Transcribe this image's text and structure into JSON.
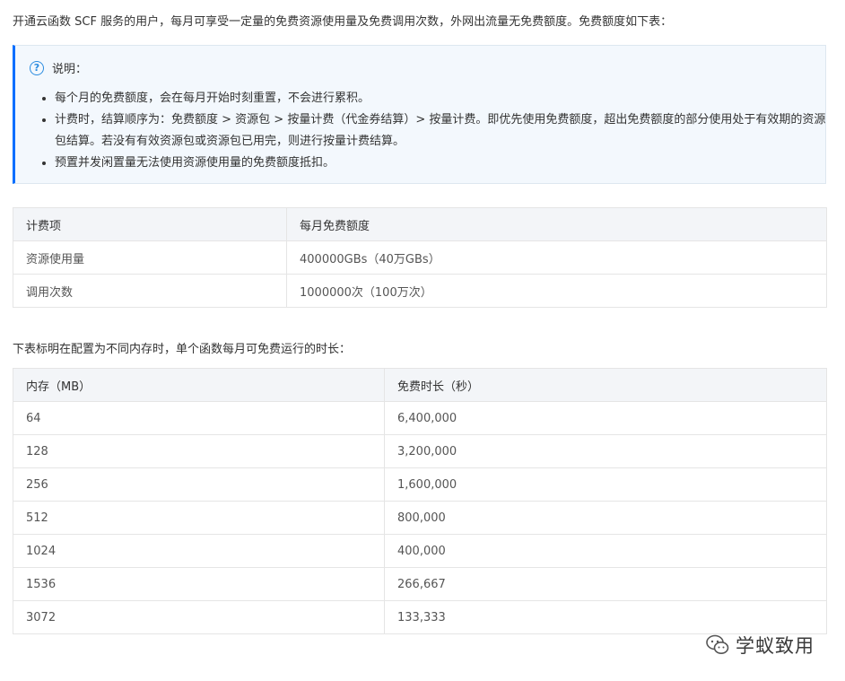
{
  "intro": "开通云函数 SCF 服务的用户，每月可享受一定量的免费资源使用量及免费调用次数，外网出流量无免费额度。免费额度如下表：",
  "note": {
    "title": "说明：",
    "items": [
      "每个月的免费额度，会在每月开始时刻重置，不会进行累积。",
      "计费时，结算顺序为：免费额度 > 资源包 > 按量计费（代金券结算）> 按量计费。即优先使用免费额度，超出免费额度的部分使用处于有效期的资源包结算。若没有有效资源包或资源包已用完，则进行按量计费结算。",
      "预置并发闲置量无法使用资源使用量的免费额度抵扣。"
    ]
  },
  "quota_table": {
    "headers": [
      "计费项",
      "每月免费额度"
    ],
    "rows": [
      [
        "资源使用量",
        "400000GBs（40万GBs）"
      ],
      [
        "调用次数",
        "1000000次（100万次）"
      ]
    ]
  },
  "subtitle": "下表标明在配置为不同内存时，单个函数每月可免费运行的时长：",
  "memory_table": {
    "headers": [
      "内存（MB）",
      "免费时长（秒）"
    ],
    "rows": [
      [
        "64",
        "6,400,000"
      ],
      [
        "128",
        "3,200,000"
      ],
      [
        "256",
        "1,600,000"
      ],
      [
        "512",
        "800,000"
      ],
      [
        "1024",
        "400,000"
      ],
      [
        "1536",
        "266,667"
      ],
      [
        "3072",
        "133,333"
      ]
    ]
  },
  "watermark": "学蚁致用"
}
